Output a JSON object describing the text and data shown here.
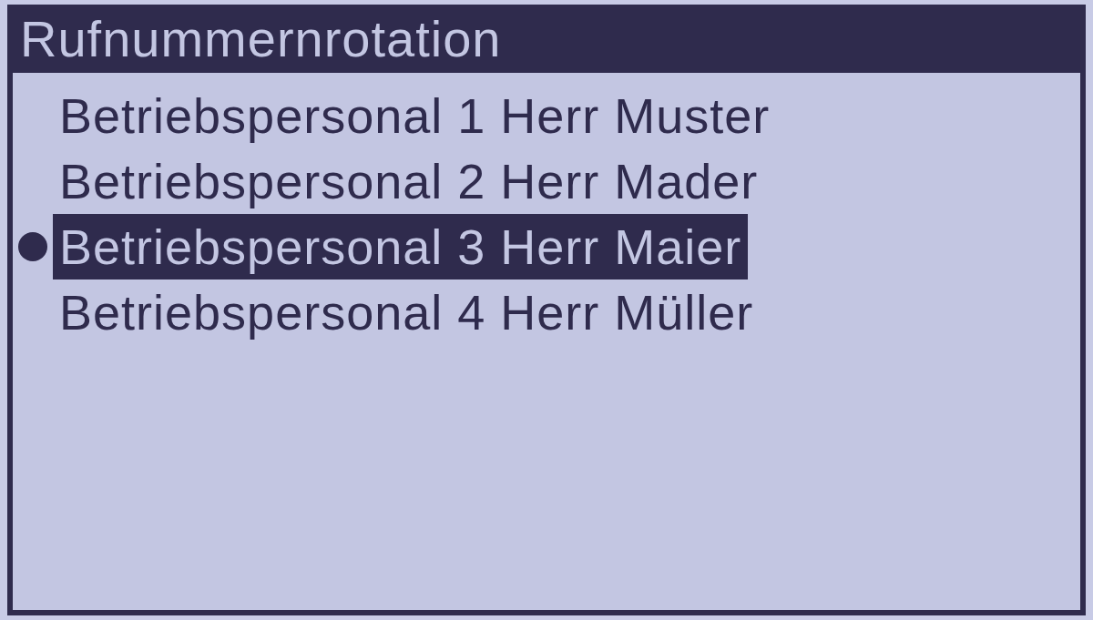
{
  "screen": {
    "title": "Rufnummernrotation",
    "items": [
      {
        "label": "Betriebspersonal 1 Herr Muster",
        "selected": false
      },
      {
        "label": "Betriebspersonal 2 Herr Mader",
        "selected": false
      },
      {
        "label": "Betriebspersonal 3 Herr Maier",
        "selected": true
      },
      {
        "label": "Betriebspersonal 4 Herr Müller",
        "selected": false
      }
    ]
  }
}
